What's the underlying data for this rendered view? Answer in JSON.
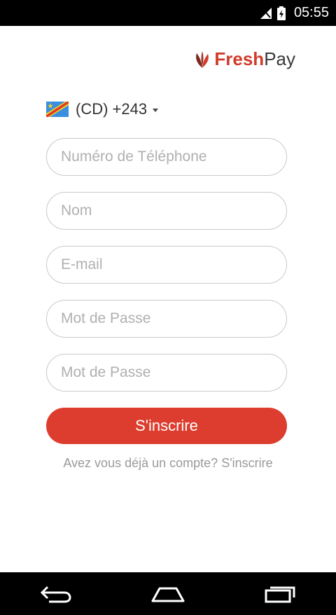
{
  "status_bar": {
    "time": "05:55"
  },
  "logo": {
    "fresh": "Fresh",
    "pay": "Pay",
    "brand_color": "#d03b2b"
  },
  "country_selector": {
    "label": "(CD) +243"
  },
  "form": {
    "phone_placeholder": "Numéro de Téléphone",
    "name_placeholder": "Nom",
    "email_placeholder": "E-mail",
    "password_placeholder": "Mot de Passe",
    "password_confirm_placeholder": "Mot de Passe",
    "submit_label": "S'inscrire",
    "submit_color": "#dc3d2e"
  },
  "footer": {
    "question": "Avez vous déjà un compte?",
    "link": "S'inscrire"
  },
  "nav_bar": {
    "icons": [
      "back-icon",
      "home-icon",
      "recents-icon"
    ]
  }
}
